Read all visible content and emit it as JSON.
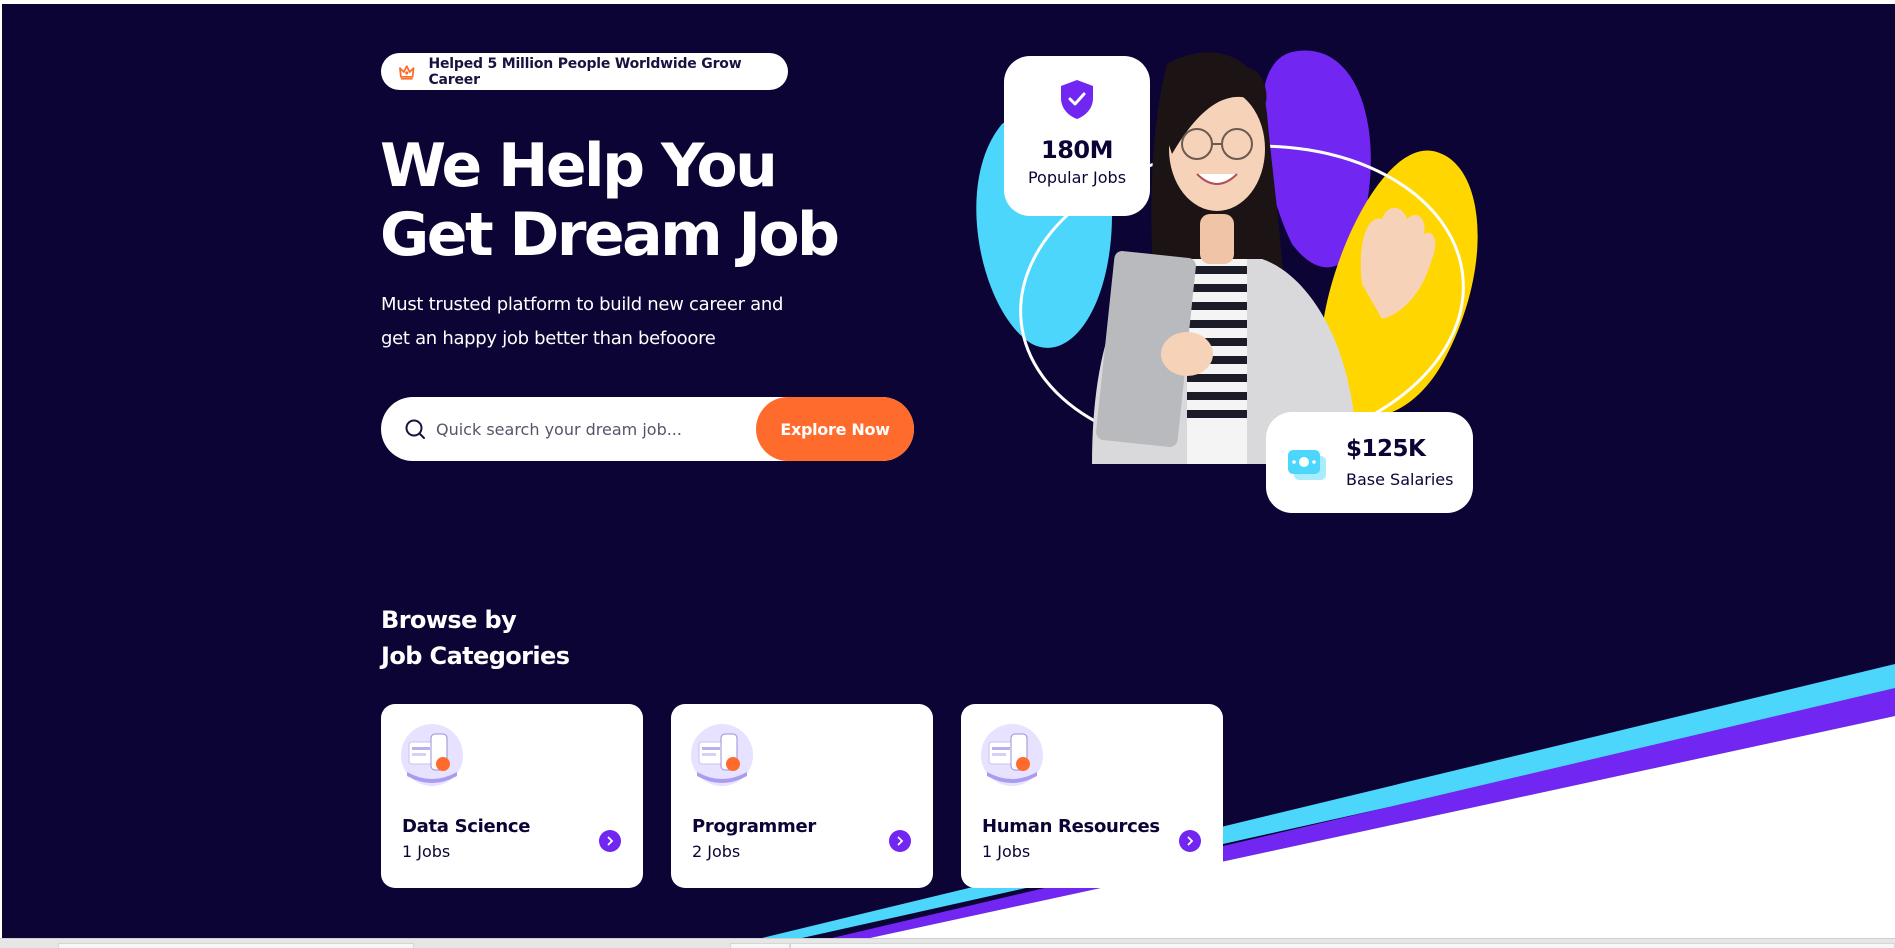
{
  "hero": {
    "badge_text": "Helped 5 Million People Worldwide Grow Career",
    "title_line1": "We Help You",
    "title_line2": "Get Dream Job",
    "subtitle_line1": "Must trusted platform to build new career and",
    "subtitle_line2": "get an happy job better than befooore",
    "search_placeholder": "Quick search your dream job...",
    "explore_label": "Explore Now"
  },
  "stats": {
    "jobs": {
      "value": "180M",
      "label": "Popular Jobs"
    },
    "salary": {
      "value": "$125K",
      "label": "Base Salaries"
    }
  },
  "browse": {
    "title_line1": "Browse by",
    "title_line2": "Job Categories",
    "categories": [
      {
        "name": "Data Science",
        "count": "1 Jobs"
      },
      {
        "name": "Programmer",
        "count": "2 Jobs"
      },
      {
        "name": "Human Resources",
        "count": "1 Jobs"
      }
    ]
  },
  "colors": {
    "background": "#0c0434",
    "accent_orange": "#ff6b2c",
    "accent_purple": "#7126f1",
    "accent_cyan": "#4dd6fb",
    "accent_yellow": "#ffd600"
  },
  "icons": {
    "badge": "crown-icon",
    "search": "search-icon",
    "jobs": "shield-check-icon",
    "salary": "money-icon",
    "category_go": "chevron-right-icon"
  }
}
